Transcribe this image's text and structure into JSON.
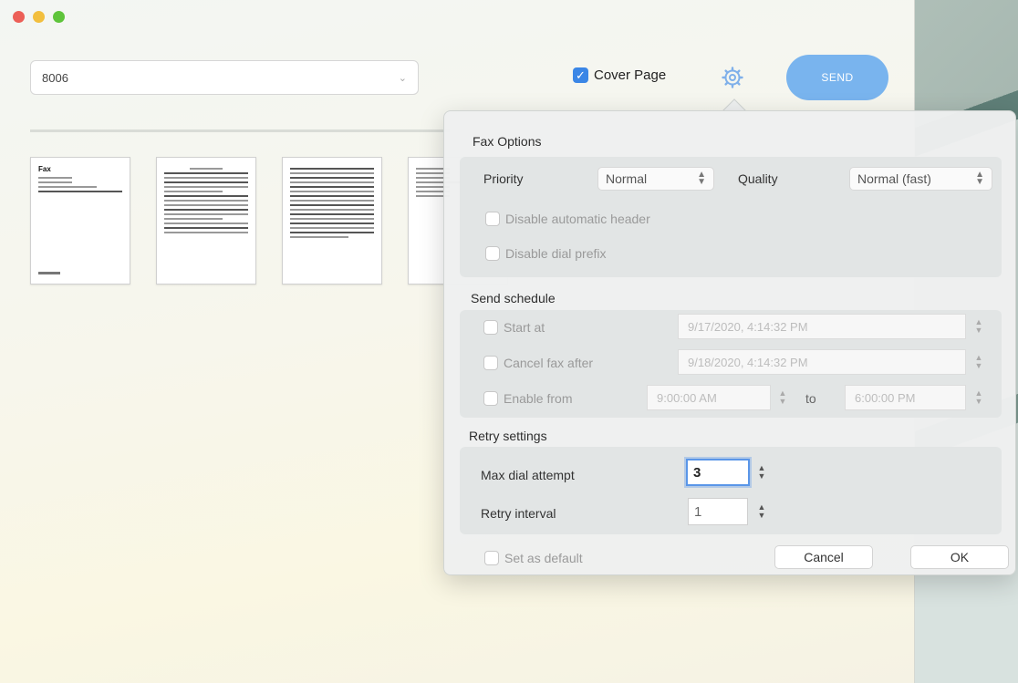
{
  "window": {
    "recipient": {
      "value": "8006"
    }
  },
  "toolbar": {
    "cover_page_label": "Cover Page",
    "cover_page_checked": true,
    "send_label": "SEND"
  },
  "thumbnails": {
    "first_title": "Fax"
  },
  "fax_options": {
    "title": "Fax Options",
    "priority_label": "Priority",
    "priority_value": "Normal",
    "quality_label": "Quality",
    "quality_value": "Normal (fast)",
    "disable_header_label": "Disable automatic header",
    "disable_dial_prefix_label": "Disable dial prefix"
  },
  "send_schedule": {
    "title": "Send schedule",
    "start_at_label": "Start at",
    "start_at_value": "9/17/2020,  4:14:32 PM",
    "cancel_after_label": "Cancel fax after",
    "cancel_after_value": "9/18/2020,  4:14:32 PM",
    "enable_from_label": "Enable from",
    "enable_from_value": "9:00:00 AM",
    "to_label": "to",
    "enable_to_value": "6:00:00 PM"
  },
  "retry_settings": {
    "title": "Retry settings",
    "max_dial_label": "Max dial attempt",
    "max_dial_value": "3",
    "retry_interval_label": "Retry interval",
    "retry_interval_value": "1"
  },
  "footer": {
    "set_default_label": "Set as default",
    "cancel_label": "Cancel",
    "ok_label": "OK"
  },
  "colors": {
    "accent": "#3a86e6",
    "send_button": "#79b4ee"
  }
}
